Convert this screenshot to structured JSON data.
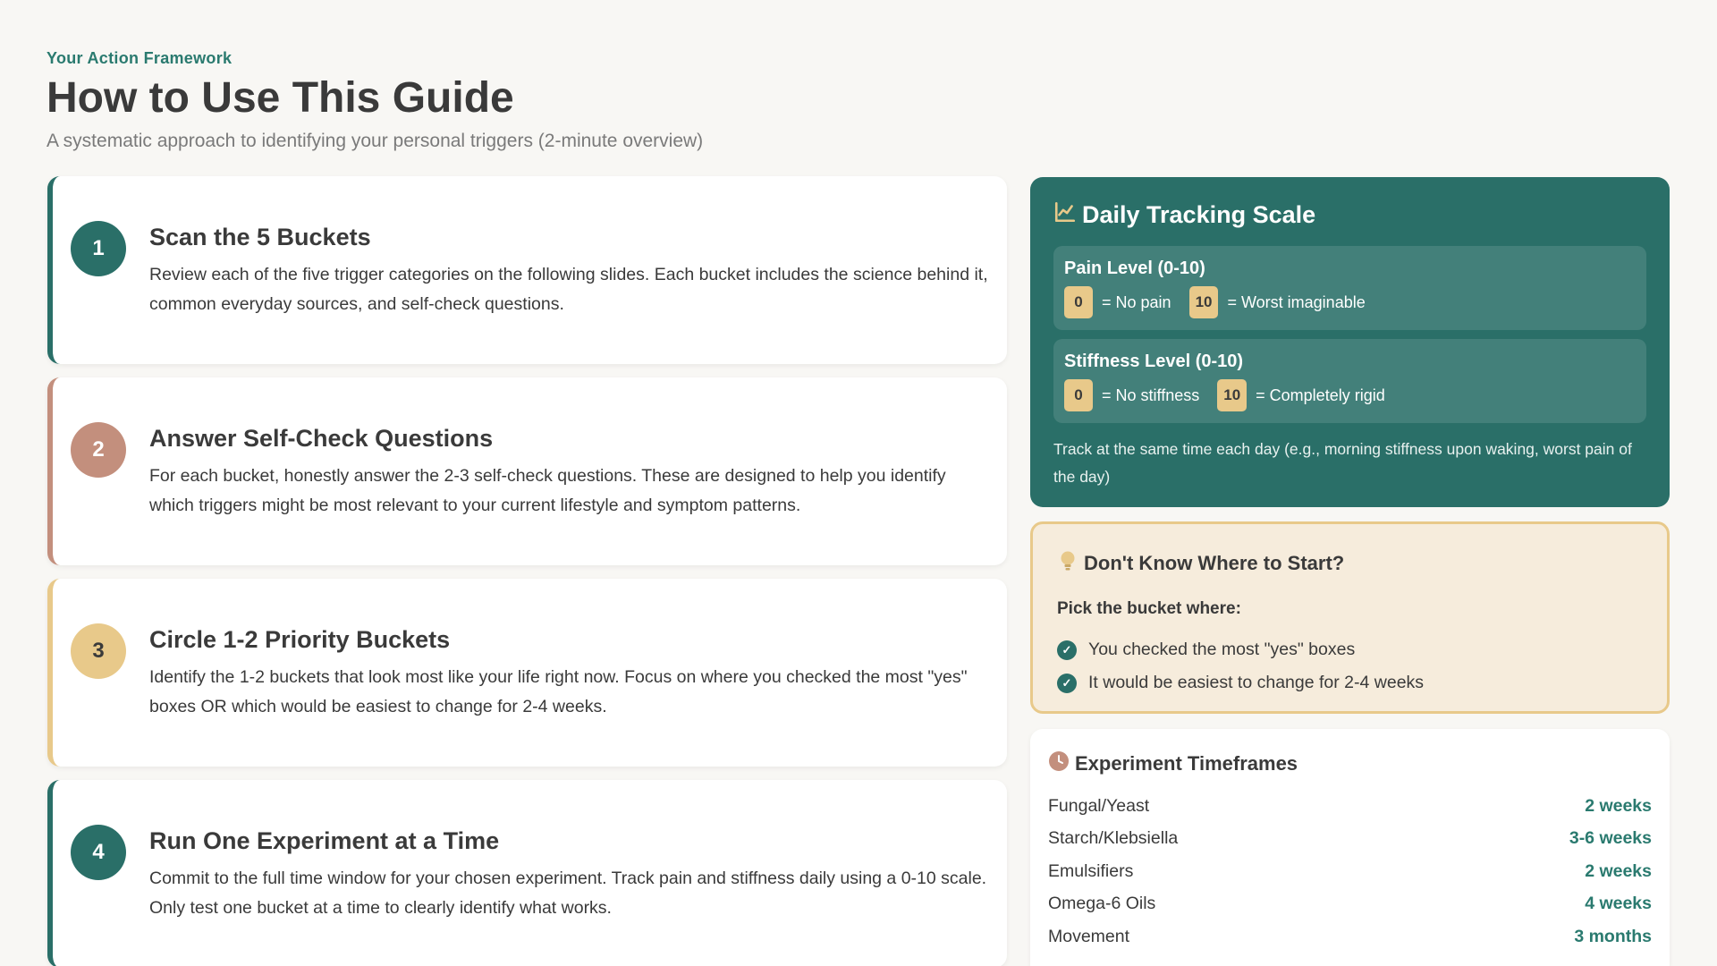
{
  "header": {
    "eyebrow": "Your Action Framework",
    "title": "How to Use This Guide",
    "subtitle": "A systematic approach to identifying your personal triggers (2-minute overview)"
  },
  "steps": [
    {
      "number": "1",
      "title": "Scan the 5 Buckets",
      "body": "Review each of the five trigger categories on the following slides. Each bucket includes the science behind it, common everyday sources, and self-check questions."
    },
    {
      "number": "2",
      "title": "Answer Self-Check Questions",
      "body": "For each bucket, honestly answer the 2-3 self-check questions. These are designed to help you identify which triggers might be most relevant to your current lifestyle and symptom patterns."
    },
    {
      "number": "3",
      "title": "Circle 1-2 Priority Buckets",
      "body": "Identify the 1-2 buckets that look most like your life right now. Focus on where you checked the most \"yes\" boxes OR which would be easiest to change for 2-4 weeks."
    },
    {
      "number": "4",
      "title": "Run One Experiment at a Time",
      "body": "Commit to the full time window for your chosen experiment. Track pain and stiffness daily using a 0-10 scale. Only test one bucket at a time to clearly identify what works."
    }
  ],
  "tracking": {
    "title": "Daily Tracking Scale",
    "icon": "chart-line-icon",
    "pain": {
      "title": "Pain Level (0-10)",
      "low": "0",
      "low_label": "= No pain",
      "high": "10",
      "high_label": "= Worst imaginable"
    },
    "stiffness": {
      "title": "Stiffness Level (0-10)",
      "low": "0",
      "low_label": "= No stiffness",
      "high": "10",
      "high_label": "= Completely rigid"
    },
    "note": "Track at the same time each day (e.g., morning stiffness upon waking, worst pain of the day)"
  },
  "start": {
    "title": "Don't Know Where to Start?",
    "icon": "lightbulb-icon",
    "subtitle": "Pick the bucket where:",
    "items": [
      "You checked the most \"yes\" boxes",
      "It would be easiest to change for 2-4 weeks"
    ]
  },
  "timeframes": {
    "title": "Experiment Timeframes",
    "icon": "clock-icon",
    "rows": [
      {
        "label": "Fungal/Yeast",
        "value": "2 weeks"
      },
      {
        "label": "Starch/Klebsiella",
        "value": "3-6 weeks"
      },
      {
        "label": "Emulsifiers",
        "value": "2 weeks"
      },
      {
        "label": "Omega-6 Oils",
        "value": "4 weeks"
      },
      {
        "label": "Movement",
        "value": "3 months"
      }
    ]
  },
  "colors": {
    "teal": "#2a6f68",
    "rose": "#c38f7d",
    "sand": "#e8c98a"
  }
}
